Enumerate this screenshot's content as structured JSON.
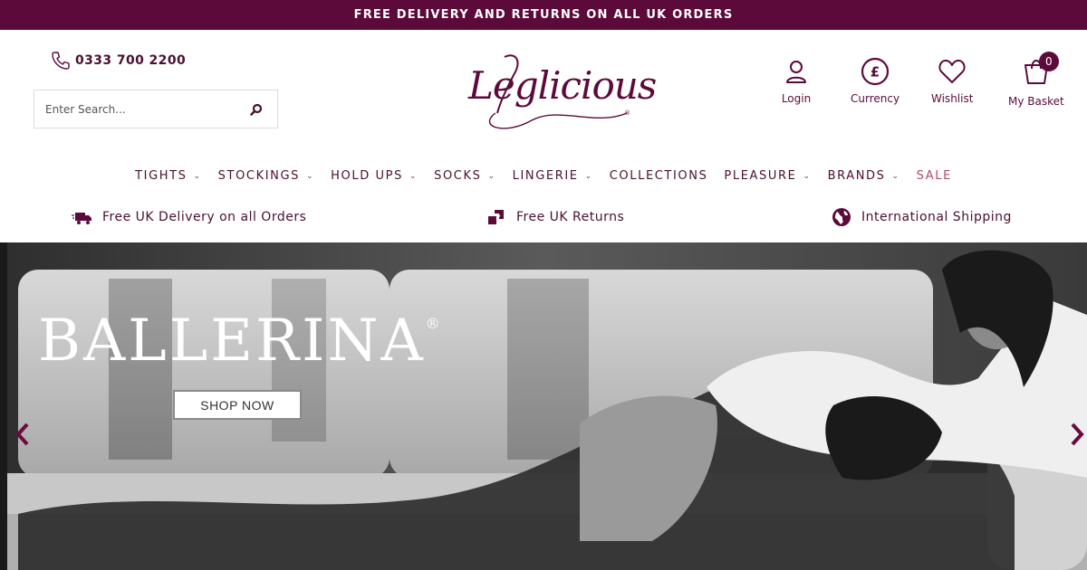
{
  "announcement": "FREE DELIVERY AND RETURNS ON ALL UK ORDERS",
  "header": {
    "phone": "0333 700 2200",
    "search_placeholder": "Enter Search...",
    "logo_text": "Leglicious",
    "account": {
      "login": "Login",
      "currency": "Currency",
      "wishlist": "Wishlist",
      "basket": "My Basket",
      "basket_count": "0"
    }
  },
  "nav": {
    "items": [
      {
        "label": "TIGHTS",
        "has_dropdown": true
      },
      {
        "label": "STOCKINGS",
        "has_dropdown": true
      },
      {
        "label": "HOLD UPS",
        "has_dropdown": true
      },
      {
        "label": "SOCKS",
        "has_dropdown": true
      },
      {
        "label": "LINGERIE",
        "has_dropdown": true
      },
      {
        "label": "COLLECTIONS",
        "has_dropdown": false
      },
      {
        "label": "PLEASURE",
        "has_dropdown": true
      },
      {
        "label": "BRANDS",
        "has_dropdown": true
      },
      {
        "label": "SALE",
        "has_dropdown": false
      }
    ]
  },
  "usps": {
    "delivery": "Free UK Delivery on all Orders",
    "returns": "Free UK Returns",
    "international": "International Shipping"
  },
  "hero": {
    "brand": "BALLERINA",
    "reg_mark": "®",
    "cta": "SHOP NOW"
  },
  "colors": {
    "brand": "#5c0a3a",
    "sale": "#b04a6a"
  },
  "icons": [
    "phone-icon",
    "search-icon",
    "user-icon",
    "currency-icon",
    "heart-icon",
    "basket-icon",
    "truck-icon",
    "returns-icon",
    "globe-icon",
    "chevron-left-icon",
    "chevron-right-icon"
  ]
}
